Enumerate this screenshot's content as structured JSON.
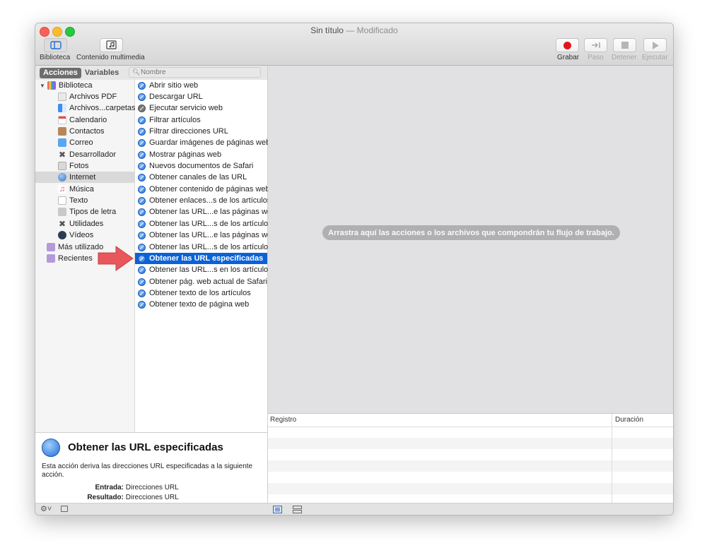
{
  "window": {
    "title": "Sin título",
    "title_status": "— Modificado"
  },
  "toolbar": {
    "library_label": "Biblioteca",
    "media_label": "Contenido multimedia",
    "record_label": "Grabar",
    "step_label": "Paso",
    "stop_label": "Detener",
    "run_label": "Ejecutar"
  },
  "tabs": {
    "actions": "Acciones",
    "variables": "Variables"
  },
  "search": {
    "placeholder": "Nombre"
  },
  "library": {
    "root": "Biblioteca",
    "items": [
      {
        "label": "Archivos PDF",
        "icon": "pdf-icon"
      },
      {
        "label": "Archivos...carpetas",
        "icon": "finder-icon"
      },
      {
        "label": "Calendario",
        "icon": "calendar-icon"
      },
      {
        "label": "Contactos",
        "icon": "contacts-icon"
      },
      {
        "label": "Correo",
        "icon": "mail-icon"
      },
      {
        "label": "Desarrollador",
        "icon": "developer-icon"
      },
      {
        "label": "Fotos",
        "icon": "photos-icon"
      },
      {
        "label": "Internet",
        "icon": "internet-icon"
      },
      {
        "label": "Música",
        "icon": "music-icon"
      },
      {
        "label": "Texto",
        "icon": "text-icon"
      },
      {
        "label": "Tipos de letra",
        "icon": "fonts-icon"
      },
      {
        "label": "Utilidades",
        "icon": "utilities-icon"
      },
      {
        "label": "Vídeos",
        "icon": "videos-icon"
      }
    ],
    "most_used": "Más utilizado",
    "recent": "Recientes",
    "selected": "Internet"
  },
  "actions": [
    "Abrir sitio web",
    "Descargar URL",
    "Ejecutar servicio web",
    "Filtrar artículos",
    "Filtrar direcciones URL",
    "Guardar imágenes de páginas web",
    "Mostrar páginas web",
    "Nuevos documentos de Safari",
    "Obtener canales de las URL",
    "Obtener contenido de páginas web",
    "Obtener enlaces...s de los artículos",
    "Obtener las URL...e las páginas web",
    "Obtener las URL...s de los artículos",
    "Obtener las URL...e las páginas web",
    "Obtener las URL...s de los artículos",
    "Obtener las URL especificadas",
    "Obtener las URL...s en los artículos",
    "Obtener pág. web actual de Safari",
    "Obtener texto de los artículos",
    "Obtener texto de página web"
  ],
  "selected_action": "Obtener las URL especificadas",
  "description": {
    "title": "Obtener las URL especificadas",
    "text": "Esta acción deriva las direcciones URL especificadas a la siguiente acción.",
    "input_label": "Entrada:",
    "input_value": "Direcciones URL",
    "result_label": "Resultado:",
    "result_value": "Direcciones URL"
  },
  "canvas": {
    "hint": "Arrastra aquí las acciones o los archivos que compondrán tu flujo de trabajo."
  },
  "log": {
    "col_log": "Registro",
    "col_duration": "Duración"
  },
  "colors": {
    "selection": "#0a62d6",
    "arrow": "#e8575b",
    "record": "#e0161c"
  }
}
